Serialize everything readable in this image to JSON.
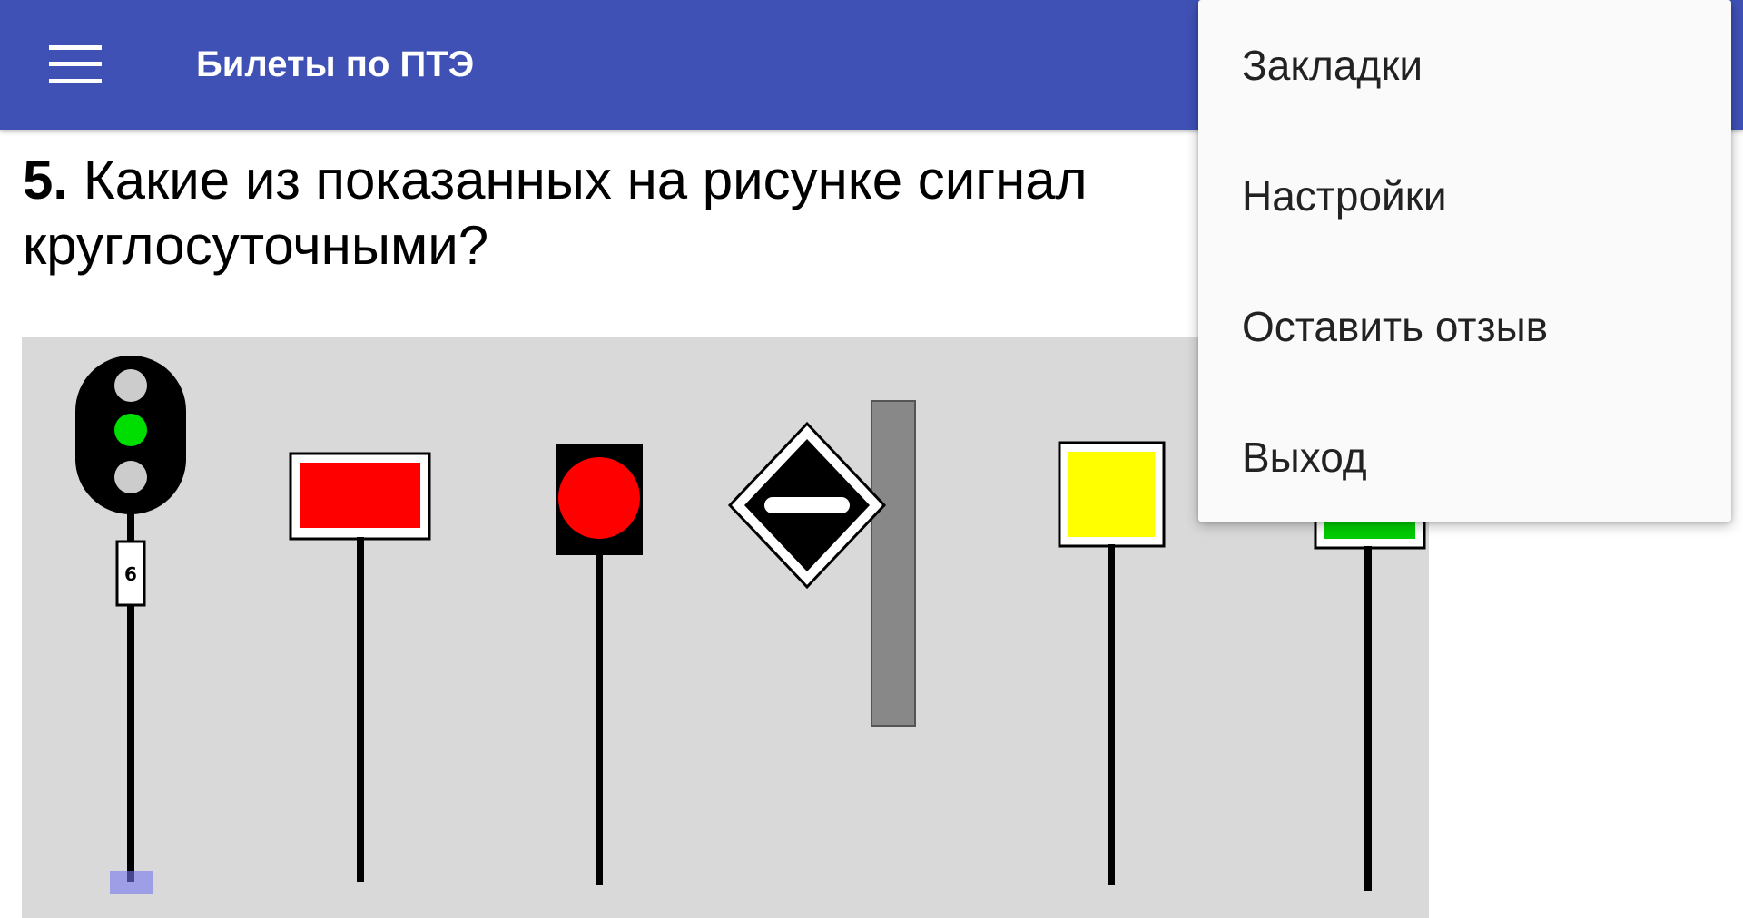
{
  "appbar": {
    "title": "Билеты по ПТЭ",
    "background": "#3f51b5",
    "menu_icon": "hamburger-menu-icon"
  },
  "question": {
    "number": "5.",
    "text": "Какие из показанных на рисунке сигналов являются круглосуточными?",
    "visible_line1": " Какие из показанных на рисунке сигнал",
    "visible_line2": "круглосуточными?"
  },
  "figure": {
    "background": "#d9d9d9",
    "signals": [
      {
        "kind": "traffic-light",
        "lamps": [
          "#cccccc",
          "#00dd00",
          "#cccccc"
        ],
        "plate_text": "6"
      },
      {
        "kind": "rect-sign",
        "color": "#ff0000"
      },
      {
        "kind": "round-disc-sign",
        "color": "#ff0000"
      },
      {
        "kind": "diamond-sign",
        "color": "#000000"
      },
      {
        "kind": "square-sign",
        "color": "#ffff00"
      },
      {
        "kind": "rect-sign",
        "color": "#00cc00"
      }
    ]
  },
  "overflow_menu": {
    "items": [
      {
        "label": "Закладки"
      },
      {
        "label": "Настройки"
      },
      {
        "label": "Оставить отзыв"
      },
      {
        "label": "Выход"
      }
    ]
  }
}
